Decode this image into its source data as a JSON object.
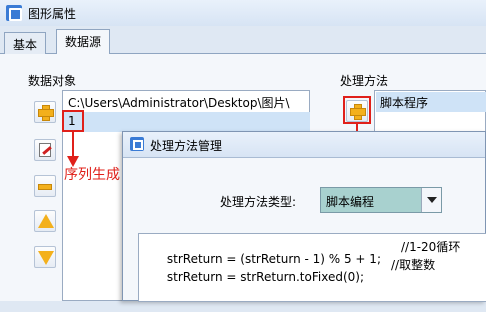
{
  "window": {
    "title": "图形属性"
  },
  "tabs": [
    {
      "label": "基本",
      "active": false
    },
    {
      "label": "数据源",
      "active": true
    }
  ],
  "data_objects": {
    "group_label": "数据对象",
    "items": [
      "C:\\Users\\Administrator\\Desktop\\图片\\",
      "1"
    ],
    "selected_index": 1,
    "buttons": [
      "add",
      "edit",
      "remove",
      "move-up",
      "move-down"
    ]
  },
  "processing": {
    "group_label": "处理方法",
    "items": [
      "脚本程序"
    ]
  },
  "annotations": {
    "sequence_label": "序列生成",
    "color": "#e0201a"
  },
  "dialog": {
    "title": "处理方法管理",
    "type_label": "处理方法类型:",
    "type_value": "脚本编程",
    "code_lines": [
      {
        "code": "strReturn = (strReturn - 1) % 5 + 1;",
        "comment": "//1-20循环"
      },
      {
        "code": "strReturn = strReturn.toFixed(0);",
        "comment": "//取整数"
      }
    ]
  },
  "colors": {
    "selection": "#cfe3f7",
    "select_bg": "#a8d1cf",
    "icon_accent": "#f3b01c"
  }
}
